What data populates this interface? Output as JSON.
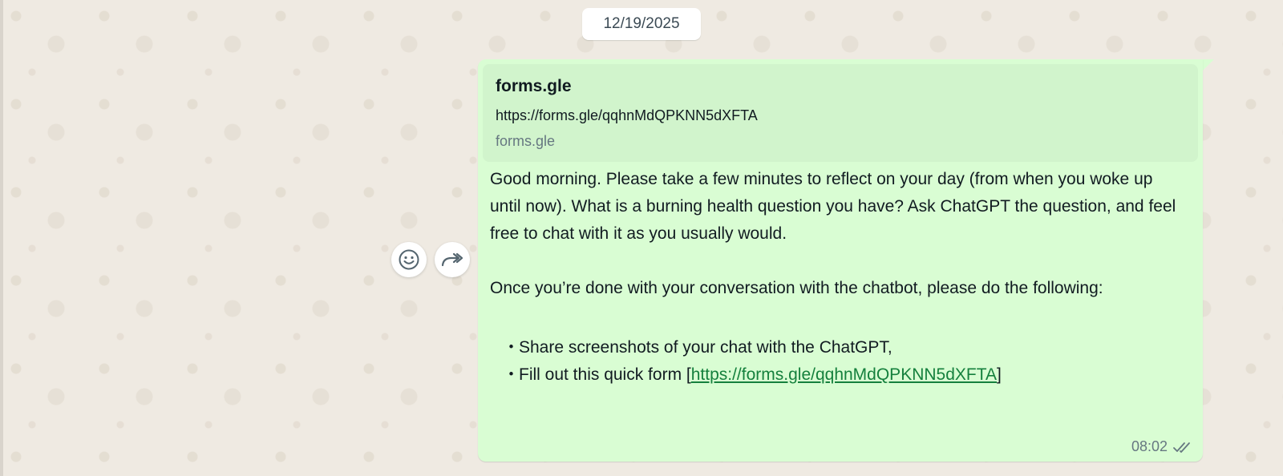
{
  "date_label": "12/19/2025",
  "link_preview": {
    "title": "forms.gle",
    "url": "https://forms.gle/qqhnMdQPKNN5dXFTA",
    "domain": "forms.gle"
  },
  "message": {
    "paragraph_1": "Good morning. Please take a few minutes to reflect on your day (from when you woke up until now). What is a burning health question you have? Ask ChatGPT the question, and feel free to chat with it as you usually would.",
    "paragraph_2": "Once you’re done with your conversation with the chatbot, please do the following:",
    "bullet_marker": "・",
    "bullet_1": "Share screenshots of your chat with the ChatGPT,",
    "bullet_2_prefix": "Fill out this quick form [",
    "bullet_2_link": "https://forms.gle/qqhnMdQPKNN5dXFTA",
    "bullet_2_suffix": "]",
    "time": "08:02",
    "status": "read"
  },
  "icons": {
    "emoji": "smiley-icon",
    "forward": "forward-icon",
    "read_receipt": "double-check-icon"
  },
  "colors": {
    "wallpaper": "#efeae2",
    "bubble": "#d9fdd3",
    "preview": "#d1f4cc",
    "link": "#15803d",
    "meta": "#667781"
  }
}
